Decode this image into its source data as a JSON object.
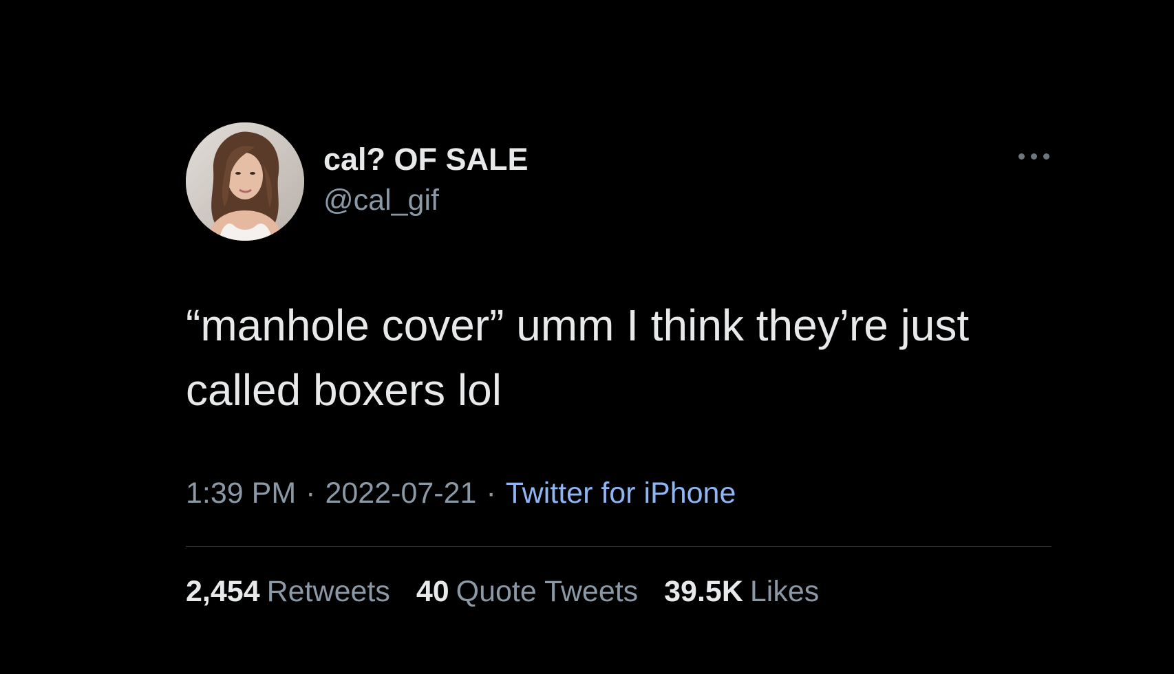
{
  "user": {
    "display_name": "cal? OF SALE",
    "handle": "@cal_gif"
  },
  "tweet": {
    "text": "“manhole cover” umm I think they’re just called boxers lol",
    "time": "1:39 PM",
    "date": "2022-07-21",
    "separator": "·",
    "source": "Twitter for iPhone"
  },
  "stats": {
    "retweets_count": "2,454",
    "retweets_label": "Retweets",
    "quotes_count": "40",
    "quotes_label": "Quote Tweets",
    "likes_count": "39.5K",
    "likes_label": "Likes"
  },
  "icons": {
    "more": "more-horizontal-icon"
  },
  "colors": {
    "background": "#000000",
    "primary_text": "#e7e9ea",
    "secondary_text": "#8b98a5",
    "link": "#8fb6f2",
    "divider": "#2f3336"
  }
}
